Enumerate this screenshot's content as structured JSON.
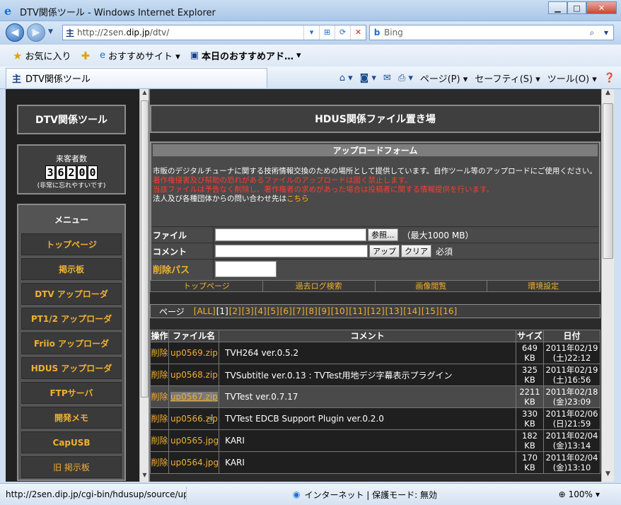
{
  "window": {
    "title": "DTV関係ツール - Windows Internet Explorer"
  },
  "address": {
    "url_prefix": "http://2sen.",
    "url_domain": "dip.jp",
    "url_suffix": "/dtv/"
  },
  "search": {
    "placeholder": "Bing"
  },
  "favorites": {
    "label": "お気に入り",
    "items": [
      "おすすめサイト ▾",
      "本日のおすすめアド…"
    ]
  },
  "tab": {
    "title": "DTV関係ツール"
  },
  "commands": {
    "page": "ページ(P) ▾",
    "safety": "セーフティ(S) ▾",
    "tools": "ツール(O) ▾"
  },
  "sidebar": {
    "title": "DTV関係ツール",
    "visitor_label": "来客者数",
    "visitor_count": [
      "3",
      "6",
      "2",
      "0",
      "0"
    ],
    "visitor_note": "(非常に忘れやすいです)",
    "menu_header": "メニュー",
    "menu": [
      "トップページ",
      "掲示板",
      "DTV アップローダ",
      "PT1/2 アップローダ",
      "Friio アップローダ",
      "HDUS アップローダ",
      "FTPサーバ",
      "開発メモ",
      "CapUSB",
      "旧 掲示板"
    ]
  },
  "main": {
    "title": "HDUS関係ファイル置き場",
    "form_title": "アップロードフォーム",
    "notice_white": "市販のデジタルチューナに関する技術情報交換のための場所として提供しています。自作ツール等のアップロードにご使用ください。",
    "notice_red1": "著作権侵害及び幇助の恐れがあるファイルのアップロードは固く禁止します。",
    "notice_red2": "当該ファイルは予告なく削除し、著作権者の求めがあった場合は投稿者に関する情報提供を行います。",
    "notice_contact": "法人及び各種団体からの問い合わせ先は",
    "notice_link": "こちら",
    "file_label": "ファイル",
    "browse_btn": "参照...",
    "max_size": "（最大1000 MB）",
    "comment_label": "コメント",
    "upload_btn": "アップ",
    "clear_btn": "クリア",
    "required": "必須",
    "delpass_label": "削除パス",
    "subnav": [
      "トップページ",
      "過去ログ検索",
      "画像閲覧",
      "環境設定"
    ],
    "pager_label": "ページ",
    "pages": [
      "[ALL]",
      "[1]",
      "[2]",
      "[3]",
      "[4]",
      "[5]",
      "[6]",
      "[7]",
      "[8]",
      "[9]",
      "[10]",
      "[11]",
      "[12]",
      "[13]",
      "[14]",
      "[15]",
      "[16]"
    ],
    "table_headers": {
      "op": "操作",
      "file": "ファイル名",
      "comment": "コメント",
      "size": "サイズ",
      "date": "日付"
    },
    "rows": [
      {
        "del": "削除",
        "file": "up0569.zip",
        "comment": "TVH264 ver.0.5.2",
        "size": "649 KB",
        "date1": "2011年02/19",
        "date2": "(土)22:12"
      },
      {
        "del": "削除",
        "file": "up0568.zip",
        "comment": "TVSubtitle ver.0.13 : TVTest用地デジ字幕表示プラグイン",
        "size": "325 KB",
        "date1": "2011年02/19",
        "date2": "(土)16:56"
      },
      {
        "del": "削除",
        "file": "up0567.zip",
        "comment": "TVTest ver.0.7.17",
        "size": "2211 KB",
        "date1": "2011年02/18",
        "date2": "(金)23:09"
      },
      {
        "del": "削除",
        "file": "up0566.zip",
        "comment": "TVTest EDCB Support Plugin ver.0.2.0",
        "size": "330 KB",
        "date1": "2011年02/06",
        "date2": "(日)21:59"
      },
      {
        "del": "削除",
        "file": "up0565.jpg",
        "comment": "KARI",
        "size": "182 KB",
        "date1": "2011年02/04",
        "date2": "(金)13:14"
      },
      {
        "del": "削除",
        "file": "up0564.jpg",
        "comment": "KARI",
        "size": "170 KB",
        "date1": "2011年02/04",
        "date2": "(金)13:10"
      }
    ]
  },
  "status": {
    "url": "http://2sen.dip.jp/cgi-bin/hdusup/source/up",
    "zone": "インターネット | 保護モード: 無効",
    "zoom": "100%"
  }
}
